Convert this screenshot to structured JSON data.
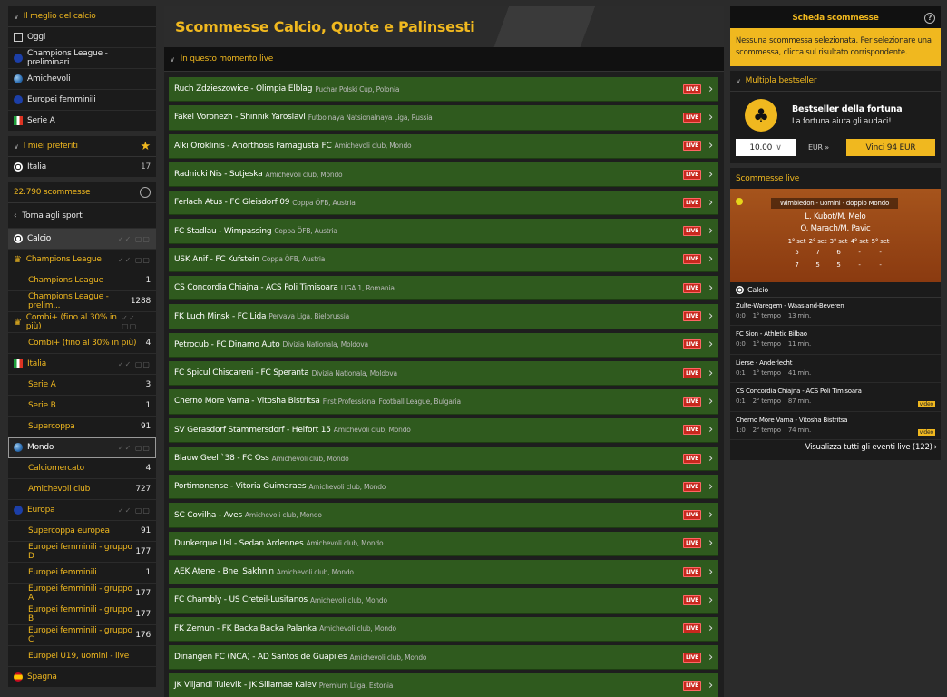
{
  "left": {
    "best": {
      "title": "Il meglio del calcio",
      "items": [
        {
          "label": "Oggi",
          "icon": "calendar-icon"
        },
        {
          "label": "Champions League - preliminari",
          "icon": "europe-icon"
        },
        {
          "label": "Amichevoli",
          "icon": "globe-icon"
        },
        {
          "label": "Europei femminili",
          "icon": "europe-icon"
        },
        {
          "label": "Serie A",
          "icon": "italy-flag-icon"
        }
      ]
    },
    "favorites": {
      "title": "I miei preferiti",
      "items": [
        {
          "label": "Italia",
          "count": "17"
        }
      ]
    },
    "bets_count": "22.790 scommesse",
    "back_label": "Torna agli sport",
    "tree": [
      {
        "type": "sport",
        "label": "Calcio"
      },
      {
        "type": "group",
        "label": "Champions League",
        "icon": "trophy"
      },
      {
        "type": "sub",
        "label": "Champions League",
        "count": "1"
      },
      {
        "type": "sub",
        "label": "Champions League - prelim...",
        "count": "1288"
      },
      {
        "type": "group",
        "label": "Combi+ (fino al 30% in più)",
        "icon": "trophy"
      },
      {
        "type": "sub",
        "label": "Combi+ (fino al 30% in più)",
        "count": "4"
      },
      {
        "type": "group",
        "label": "Italia",
        "icon": "italy"
      },
      {
        "type": "sub",
        "label": "Serie A",
        "count": "3"
      },
      {
        "type": "sub",
        "label": "Serie B",
        "count": "1"
      },
      {
        "type": "sub",
        "label": "Supercoppa",
        "count": "91"
      },
      {
        "type": "group",
        "label": "Mondo",
        "icon": "globe",
        "selected": true
      },
      {
        "type": "sub",
        "label": "Calciomercato",
        "count": "4"
      },
      {
        "type": "sub",
        "label": "Amichevoli club",
        "count": "727"
      },
      {
        "type": "group",
        "label": "Europa",
        "icon": "europe"
      },
      {
        "type": "sub",
        "label": "Supercoppa europea",
        "count": "91"
      },
      {
        "type": "sub",
        "label": "Europei femminili - gruppo D",
        "count": "177"
      },
      {
        "type": "sub",
        "label": "Europei femminili",
        "count": "1"
      },
      {
        "type": "sub",
        "label": "Europei femminili - gruppo A",
        "count": "177"
      },
      {
        "type": "sub",
        "label": "Europei femminili - gruppo B",
        "count": "177"
      },
      {
        "type": "sub",
        "label": "Europei femminili - gruppo C",
        "count": "176"
      },
      {
        "type": "sub",
        "label": "Europei U19, uomini - live",
        "count": ""
      },
      {
        "type": "group",
        "label": "Spagna",
        "icon": "spain"
      }
    ]
  },
  "main": {
    "title": "Scommesse Calcio, Quote e Palinsesti",
    "live_title": "In questo momento live",
    "live_badge": "LIVE",
    "events": [
      {
        "teams": "Ruch Zdzieszowice - Olimpia Elblag",
        "comp": "Puchar Polski Cup, Polonia"
      },
      {
        "teams": "Fakel Voronezh - Shinnik Yaroslavl",
        "comp": "Futbolnaya Natsionalnaya Liga, Russia"
      },
      {
        "teams": "Alki Oroklinis - Anorthosis Famagusta FC",
        "comp": "Amichevoli club, Mondo"
      },
      {
        "teams": "Radnicki Nis - Sutjeska",
        "comp": "Amichevoli club, Mondo"
      },
      {
        "teams": "Ferlach Atus - FC Gleisdorf 09",
        "comp": "Coppa ÖFB, Austria"
      },
      {
        "teams": "FC Stadlau - Wimpassing",
        "comp": "Coppa ÖFB, Austria"
      },
      {
        "teams": "USK Anif - FC Kufstein",
        "comp": "Coppa ÖFB, Austria"
      },
      {
        "teams": "CS Concordia Chiajna - ACS Poli Timisoara",
        "comp": "LIGA 1, Romania"
      },
      {
        "teams": "FK Luch Minsk - FC Lida",
        "comp": "Pervaya Liga, Bielorussia"
      },
      {
        "teams": "Petrocub - FC Dinamo Auto",
        "comp": "Divizia Nationala, Moldova"
      },
      {
        "teams": "FC Spicul Chiscareni - FC Speranta",
        "comp": "Divizia Nationala, Moldova"
      },
      {
        "teams": "Cherno More Varna - Vitosha Bistritsa",
        "comp": "First Professional Football League, Bulgaria"
      },
      {
        "teams": "SV Gerasdorf Stammersdorf - Helfort 15",
        "comp": "Amichevoli club, Mondo"
      },
      {
        "teams": "Blauw Geel `38 - FC Oss",
        "comp": "Amichevoli club, Mondo"
      },
      {
        "teams": "Portimonense - Vitoria Guimaraes",
        "comp": "Amichevoli club, Mondo"
      },
      {
        "teams": "SC Covilha - Aves",
        "comp": "Amichevoli club, Mondo"
      },
      {
        "teams": "Dunkerque Usl - Sedan Ardennes",
        "comp": "Amichevoli club, Mondo"
      },
      {
        "teams": "AEK Atene - Bnei Sakhnin",
        "comp": "Amichevoli club, Mondo"
      },
      {
        "teams": "FC Chambly - US Creteil-Lusitanos",
        "comp": "Amichevoli club, Mondo"
      },
      {
        "teams": "FK Zemun - FK Backa Backa Palanka",
        "comp": "Amichevoli club, Mondo"
      },
      {
        "teams": "Diriangen FC (NCA) - AD Santos de Guapiles",
        "comp": "Amichevoli club, Mondo"
      },
      {
        "teams": "JK Viljandi Tulevik - JK Sillamae Kalev",
        "comp": "Premium Liiga, Estonia"
      }
    ]
  },
  "right": {
    "slip_tab": "Scheda scommesse",
    "help": "?",
    "notice": "Nessuna scommessa selezionata. Per selezionare una scommessa, clicca sul risultato corrispondente.",
    "multi_title": "Multipla bestseller",
    "best_title": "Bestseller della fortuna",
    "best_sub": "La fortuna aiuta gli audaci!",
    "stake": "10.00",
    "currency": "EUR",
    "win_label": "Vinci 94 EUR",
    "live_title": "Scommesse live",
    "tennis": {
      "match": "Wimbledon - uomini - doppio Mondo",
      "p1": "L. Kubot/M. Melo",
      "p2": "O. Marach/M. Pavic",
      "sets": [
        "1° set",
        "2° set",
        "3° set",
        "4° set",
        "5° set"
      ],
      "row1": [
        "5",
        "7",
        "6",
        "-",
        "-"
      ],
      "row2": [
        "7",
        "5",
        "5",
        "-",
        "-"
      ]
    },
    "sport_label": "Calcio",
    "matches": [
      {
        "teams": "Zulte-Waregem - Waasland-Beveren",
        "score": "0:0",
        "period": "1° tempo",
        "time": "13 min.",
        "video": false
      },
      {
        "teams": "FC Sion - Athletic Bilbao",
        "score": "0:0",
        "period": "1° tempo",
        "time": "11 min.",
        "video": false
      },
      {
        "teams": "Lierse - Anderlecht",
        "score": "0:1",
        "period": "1° tempo",
        "time": "41 min.",
        "video": false
      },
      {
        "teams": "CS Concordia Chiajna - ACS Poli Timisoara",
        "score": "0:1",
        "period": "2° tempo",
        "time": "87 min.",
        "video": true
      },
      {
        "teams": "Cherno More Varna - Vitosha Bistritsa",
        "score": "1:0",
        "period": "2° tempo",
        "time": "74 min.",
        "video": true
      }
    ],
    "video_label": "video",
    "all_live": "Visualizza tutti gli eventi live (122)"
  }
}
